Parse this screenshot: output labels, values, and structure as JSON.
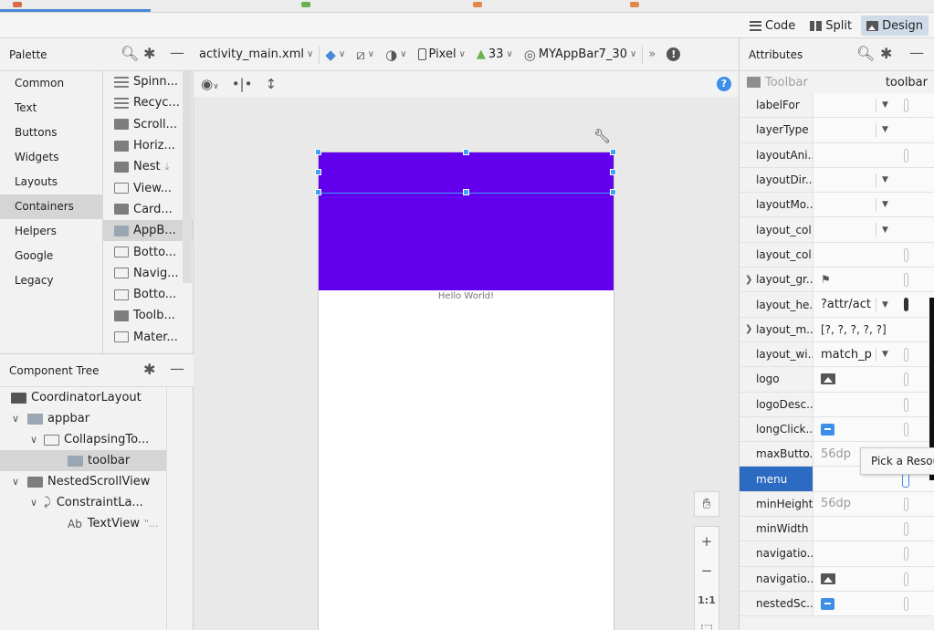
{
  "modes": {
    "code": "Code",
    "split": "Split",
    "design": "Design"
  },
  "palette": {
    "title": "Palette",
    "categories": [
      "Common",
      "Text",
      "Buttons",
      "Widgets",
      "Layouts",
      "Containers",
      "Helpers",
      "Google",
      "Legacy"
    ],
    "items": [
      "Spinn...",
      "Recyc...",
      "Scroll...",
      "Horiz...",
      "Nest",
      "View...",
      "Card...",
      "AppB...",
      "Botto...",
      "Navig...",
      "Botto...",
      "Toolb...",
      "Mater..."
    ]
  },
  "component_tree": {
    "title": "Component Tree",
    "nodes": [
      "CoordinatorLayout",
      "appbar",
      "CollapsingTo...",
      "toolbar",
      "NestedScrollView",
      "ConstraintLa...",
      "TextView"
    ],
    "textview_prefix": "Ab",
    "textview_hint": "\"..."
  },
  "design_toolbar": {
    "file": "activity_main.xml",
    "device": "Pixel",
    "api": "33",
    "theme": "MYAppBar7_30",
    "more": "»"
  },
  "canvas": {
    "appbar_color": "#6200ee",
    "hello_text": "Hello World!",
    "zoom_in": "+",
    "zoom_out": "−",
    "zoom_actual": "1:1"
  },
  "attributes": {
    "title": "Attributes",
    "view_type": "Toolbar",
    "view_id": "toolbar",
    "rows": [
      {
        "name": "labelFor",
        "value": ""
      },
      {
        "name": "layerType",
        "value": ""
      },
      {
        "name": "layoutAni...",
        "value": ""
      },
      {
        "name": "layoutDir...",
        "value": ""
      },
      {
        "name": "layoutMo...",
        "value": ""
      },
      {
        "name": "layout_col...",
        "value": ""
      },
      {
        "name": "layout_col...",
        "value": ""
      },
      {
        "name": "layout_gr...",
        "value": ""
      },
      {
        "name": "layout_he...",
        "value": "?attr/act"
      },
      {
        "name": "layout_m...",
        "value": "[?, ?, ?, ?, ?]"
      },
      {
        "name": "layout_wi...",
        "value": "match_p"
      },
      {
        "name": "logo",
        "value": ""
      },
      {
        "name": "logoDesc...",
        "value": ""
      },
      {
        "name": "longClick...",
        "value": ""
      },
      {
        "name": "maxButto...",
        "value": "56dp"
      },
      {
        "name": "menu",
        "value": ""
      },
      {
        "name": "minHeight",
        "value": "56dp"
      },
      {
        "name": "minWidth",
        "value": ""
      },
      {
        "name": "navigatio...",
        "value": ""
      },
      {
        "name": "navigatio...",
        "value": ""
      },
      {
        "name": "nestedSc...",
        "value": ""
      }
    ],
    "tooltip": "Pick a Resource"
  }
}
